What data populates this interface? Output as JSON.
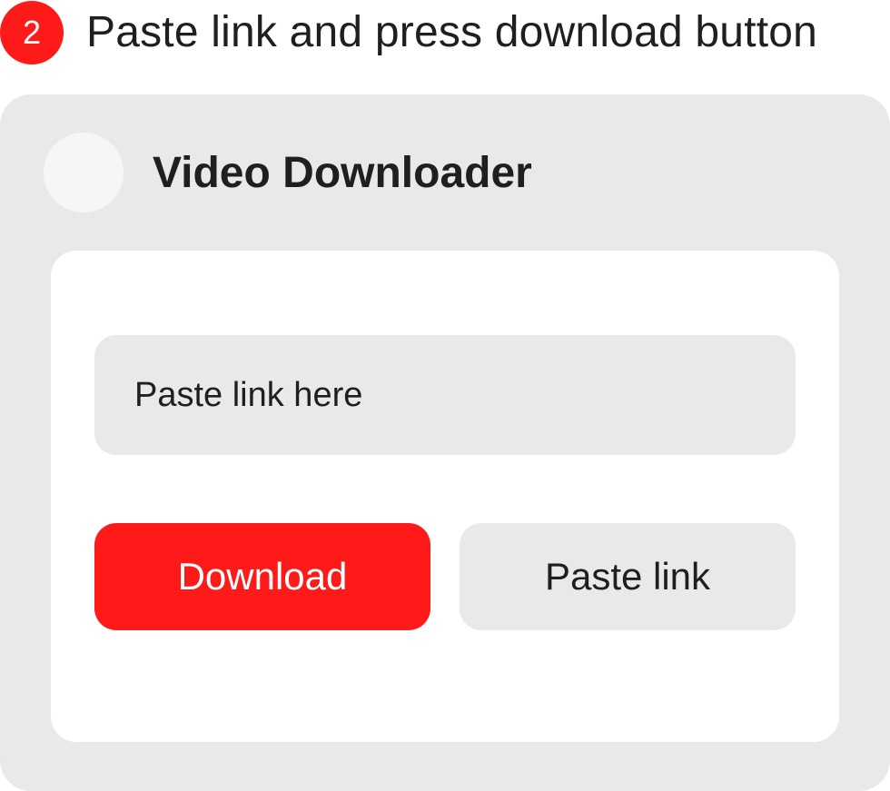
{
  "step": {
    "number": "2",
    "title": "Paste link and press download button"
  },
  "app": {
    "title": "Video Downloader"
  },
  "link_input": {
    "placeholder": "Paste link here",
    "value": ""
  },
  "buttons": {
    "download_label": "Download",
    "paste_label": "Paste link"
  },
  "colors": {
    "accent": "#ff1a1a",
    "card_background": "#e9e9e9",
    "panel_background": "#ffffff",
    "text": "#1f1f1f"
  }
}
